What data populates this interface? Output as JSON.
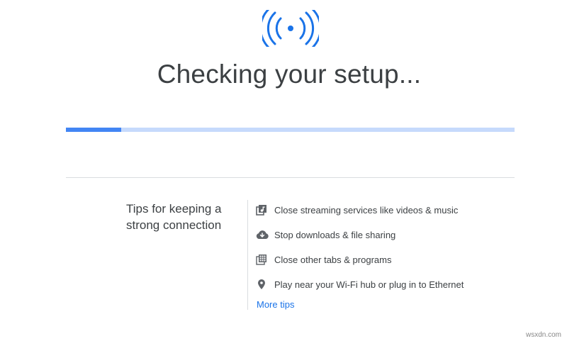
{
  "header": {
    "icon": "wifi-broadcast-icon",
    "title": "Checking your setup..."
  },
  "progress": {
    "fraction": 0.123,
    "fill_color": "#4285f4",
    "track_color": "#c6dafc"
  },
  "tips": {
    "heading": "Tips for keeping a strong connection",
    "items": [
      {
        "icon": "music-library-icon",
        "label": "Close streaming services like videos & music"
      },
      {
        "icon": "cloud-download-icon",
        "label": "Stop downloads & file sharing"
      },
      {
        "icon": "tabs-grid-icon",
        "label": "Close other tabs & programs"
      },
      {
        "icon": "location-pin-icon",
        "label": "Play near your Wi-Fi hub or plug in to Ethernet"
      }
    ],
    "more_link": "More tips"
  },
  "watermark": "wsxdn.com",
  "colors": {
    "accent": "#1a73e8",
    "text": "#3c4043",
    "icon": "#5f6368"
  }
}
